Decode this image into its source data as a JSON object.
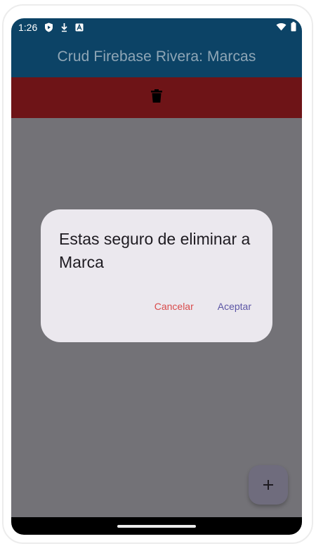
{
  "status_bar": {
    "time": "1:26",
    "icons": [
      "shield-play-icon",
      "download-icon",
      "a-badge-icon",
      "wifi-icon",
      "battery-icon"
    ]
  },
  "app_bar": {
    "title": "Crud Firebase Rivera: Marcas"
  },
  "delete_bar": {
    "icon": "trash-icon"
  },
  "dialog": {
    "title": "Estas seguro de eliminar a Marca",
    "cancel_label": "Cancelar",
    "accept_label": "Aceptar"
  },
  "fab": {
    "label": "+"
  },
  "colors": {
    "app_bar": "#0c4366",
    "delete_bar": "#6e1417",
    "scrim": "#737277",
    "dialog_bg": "#ebe8ee",
    "cancel": "#d94b4b",
    "accept": "#5c56a5"
  }
}
